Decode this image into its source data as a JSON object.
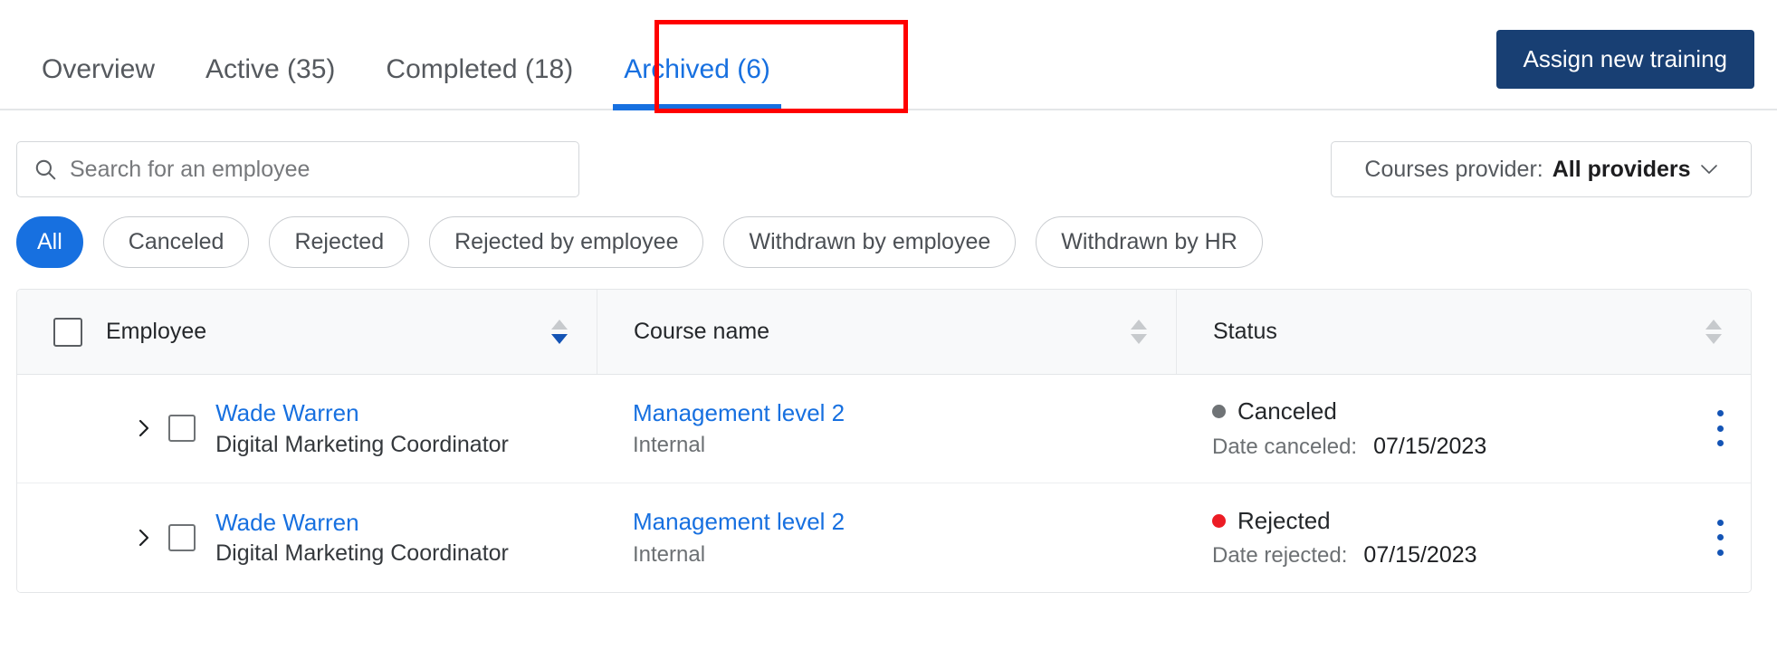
{
  "tabs": [
    {
      "label": "Overview",
      "active": false
    },
    {
      "label": "Active (35)",
      "active": false
    },
    {
      "label": "Completed (18)",
      "active": false
    },
    {
      "label": "Archived (6)",
      "active": true
    }
  ],
  "header": {
    "assign_button": "Assign new training"
  },
  "search": {
    "placeholder": "Search for an employee",
    "value": ""
  },
  "provider": {
    "label": "Courses provider:",
    "value": "All providers"
  },
  "chips": [
    {
      "label": "All",
      "active": true
    },
    {
      "label": "Canceled",
      "active": false
    },
    {
      "label": "Rejected",
      "active": false
    },
    {
      "label": "Rejected by employee",
      "active": false
    },
    {
      "label": "Withdrawn by employee",
      "active": false
    },
    {
      "label": "Withdrawn by HR",
      "active": false
    }
  ],
  "table": {
    "columns": [
      {
        "label": "Employee",
        "sort": "desc"
      },
      {
        "label": "Course name",
        "sort": "none"
      },
      {
        "label": "Status",
        "sort": "none"
      }
    ],
    "rows": [
      {
        "employee_name": "Wade Warren",
        "employee_title": "Digital Marketing Coordinator",
        "course_name": "Management level 2",
        "course_provider": "Internal",
        "status": "Canceled",
        "status_color": "#6f7376",
        "date_label": "Date canceled:",
        "date_value": "07/15/2023"
      },
      {
        "employee_name": "Wade Warren",
        "employee_title": "Digital Marketing Coordinator",
        "course_name": "Management level 2",
        "course_provider": "Internal",
        "status": "Rejected",
        "status_color": "#ec1c24",
        "date_label": "Date rejected:",
        "date_value": "07/15/2023"
      }
    ]
  },
  "colors": {
    "accent_blue": "#1770e0",
    "navy": "#183f73",
    "highlight_red": "#ff0000"
  }
}
